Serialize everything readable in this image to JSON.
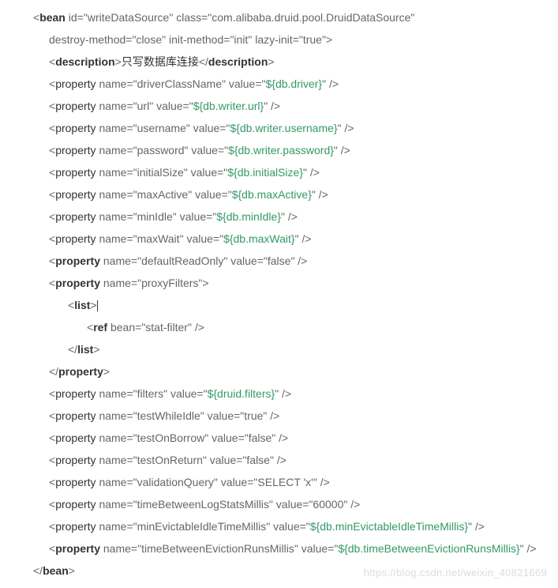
{
  "watermark": "https://blog.csdn.net/weixin_40821669",
  "bean": {
    "tag": "bean",
    "id": "writeDataSource",
    "class": "com.alibaba.druid.pool.DruidDataSource",
    "destroyMethod": "close",
    "initMethod": "init",
    "lazyInit": "true"
  },
  "description": {
    "tag": "description",
    "text": "只写数据库连接"
  },
  "props": {
    "driverClassName": {
      "name": "driverClassName",
      "value": "${db.driver}"
    },
    "url": {
      "name": "url",
      "value": "${db.writer.url}"
    },
    "username": {
      "name": "username",
      "value": "${db.writer.username}"
    },
    "password": {
      "name": "password",
      "value": "${db.writer.password}"
    },
    "initialSize": {
      "name": "initialSize",
      "value": "${db.initialSize}"
    },
    "maxActive": {
      "name": "maxActive",
      "value": "${db.maxActive}"
    },
    "minIdle": {
      "name": "minIdle",
      "value": "${db.minIdle}"
    },
    "maxWait": {
      "name": "maxWait",
      "value": "${db.maxWait}"
    },
    "defaultReadOnly": {
      "name": "defaultReadOnly",
      "value": "false"
    },
    "proxyFilters": {
      "name": "proxyFilters"
    },
    "filters": {
      "name": "filters",
      "value": "${druid.filters}"
    },
    "testWhileIdle": {
      "name": "testWhileIdle",
      "value": "true"
    },
    "testOnBorrow": {
      "name": "testOnBorrow",
      "value": "false"
    },
    "testOnReturn": {
      "name": "testOnReturn",
      "value": "false"
    },
    "validationQuery": {
      "name": "validationQuery",
      "value": "SELECT 'x'"
    },
    "timeBetweenLogStatsMillis": {
      "name": "timeBetweenLogStatsMillis",
      "value": "60000"
    },
    "minEvictableIdleTimeMillis": {
      "name": "minEvictableIdleTimeMillis",
      "value": "${db.minEvictableIdleTimeMillis}"
    },
    "timeBetweenEvictionRunsMillis": {
      "name": "timeBetweenEvictionRunsMillis",
      "value": "${db.timeBetweenEvictionRunsMillis}"
    }
  },
  "list": {
    "tag": "list"
  },
  "ref": {
    "tag": "ref",
    "bean": "stat-filter"
  },
  "propertyTag": "property",
  "propertyClose": "property"
}
